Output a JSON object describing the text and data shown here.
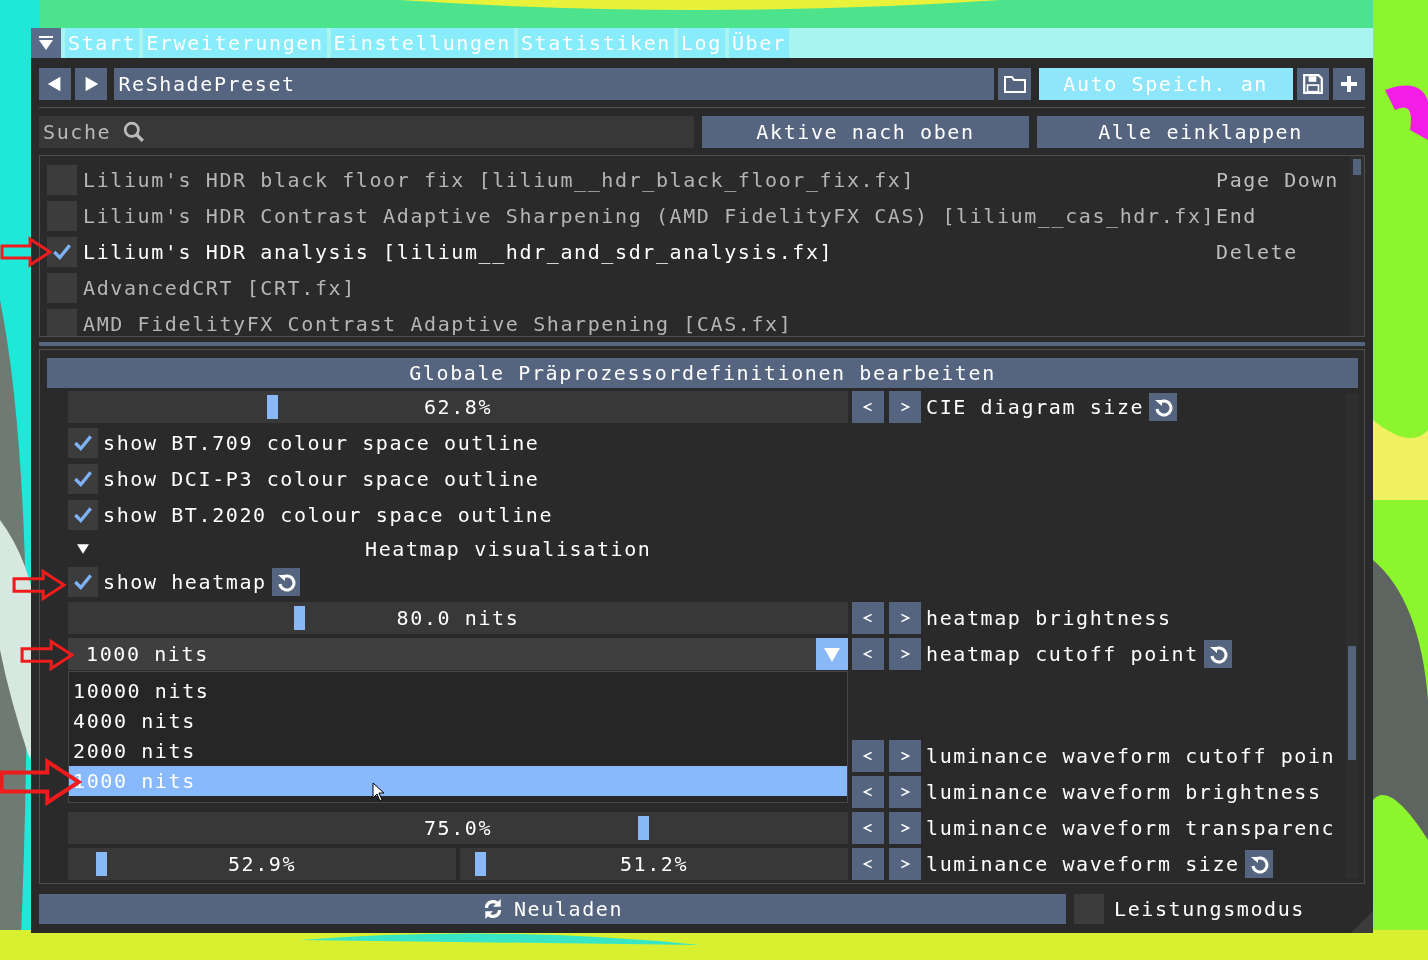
{
  "tabs": [
    {
      "label": "Start"
    },
    {
      "label": "Erweiterungen"
    },
    {
      "label": "Einstellungen"
    },
    {
      "label": "Statistiken"
    },
    {
      "label": "Log"
    },
    {
      "label": "Über"
    }
  ],
  "preset": {
    "value": "ReShadePreset"
  },
  "auto_save": {
    "label": "Auto Speich. an",
    "on": true
  },
  "search": {
    "placeholder": "Suche"
  },
  "buttons": [
    "Aktive nach oben",
    "Alle einklappen"
  ],
  "effects": [
    {
      "label": "Lilium's HDR black floor fix [lilium__hdr_black_floor_fix.fx]",
      "checked": false
    },
    {
      "label": "Lilium's HDR Contrast Adaptive Sharpening (AMD FidelityFX CAS) [lilium__cas_hdr.fx]",
      "checked": false
    },
    {
      "label": "Lilium's HDR analysis [lilium__hdr_and_sdr_analysis.fx]",
      "checked": true
    },
    {
      "label": "AdvancedCRT [CRT.fx]",
      "checked": false
    },
    {
      "label": "AMD FidelityFX Contrast Adaptive Sharpening [CAS.fx]",
      "checked": false
    }
  ],
  "context_menu": [
    "Page Down",
    "End",
    "Delete"
  ],
  "settings": {
    "title": "Globale Präprozessordefinitionen bearbeiten",
    "rows": [
      {
        "kind": "slider",
        "level": 0.26,
        "reading": "62.8%",
        "label": "CIE diagram size",
        "reset": true
      },
      {
        "kind": "checkbox",
        "label": "show BT.709 colour space outline",
        "checked": true,
        "reset": false
      },
      {
        "kind": "checkbox",
        "label": "show DCI-P3 colour space outline",
        "checked": true,
        "reset": false
      },
      {
        "kind": "checkbox",
        "label": "show BT.2020 colour space outline",
        "checked": true,
        "reset": false
      },
      {
        "kind": "header",
        "label": "Heatmap visualisation",
        "expanded": true
      },
      {
        "kind": "checkbox",
        "label": "show heatmap",
        "checked": true,
        "reset": true
      },
      {
        "kind": "slider",
        "level": 0.295,
        "reading": "80.0 nits",
        "label": "heatmap brightness",
        "reset": false
      },
      {
        "kind": "combo",
        "selection": "1000 nits",
        "label": "heatmap cutoff point",
        "reset": true,
        "open": true
      },
      {
        "kind": "covered",
        "label": "luminance waveform cutoff poin",
        "reset": false
      },
      {
        "kind": "covered",
        "label": "luminance waveform brightness",
        "reset": false
      },
      {
        "kind": "slider",
        "level": 0.744,
        "reading": "75.0%",
        "label": "luminance waveform transparenc",
        "reset": false
      },
      {
        "kind": "dual_slider",
        "sliders": [
          {
            "level": 0.075,
            "reading": "52.9%"
          },
          {
            "level": 0.04,
            "reading": "51.2%"
          }
        ],
        "label": "luminance waveform size",
        "reset": true
      }
    ],
    "popup": [
      {
        "label": "10000 nits",
        "selected": false
      },
      {
        "label": "4000 nits",
        "selected": false
      },
      {
        "label": "2000 nits",
        "selected": false
      },
      {
        "label": "1000 nits",
        "selected": true
      }
    ]
  },
  "footer": {
    "reload": "Neuladen",
    "performance_mode": {
      "label": "Leistungsmodus",
      "checked": false
    }
  }
}
